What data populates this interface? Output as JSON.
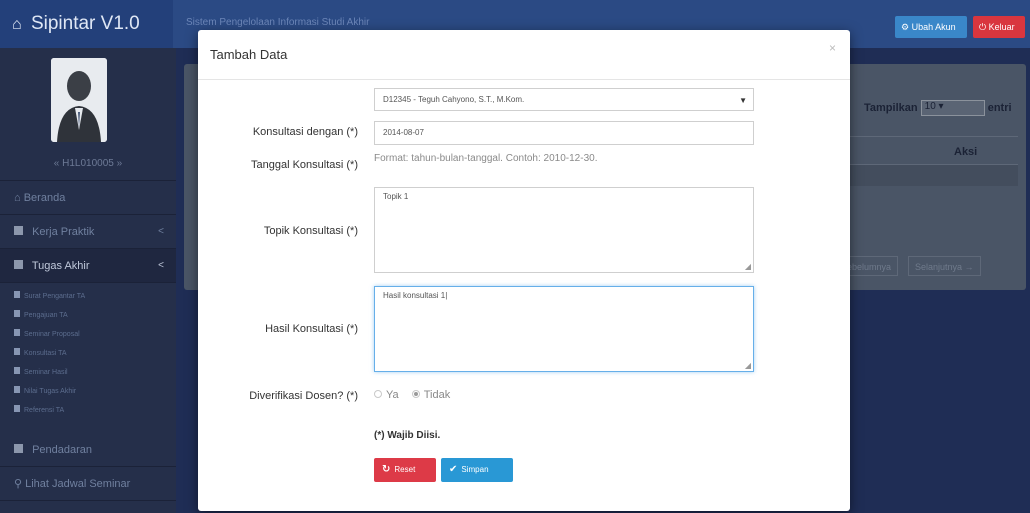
{
  "app": {
    "brand": "Sipintar V1.0",
    "subtitle": "Sistem Pengelolaan Informasi Studi Akhir",
    "btn_akun": "Ubah Akun",
    "btn_keluar": "Keluar"
  },
  "sidebar": {
    "username": "« H1L010005 »",
    "items": [
      {
        "label": "Beranda"
      },
      {
        "label": "Kerja Praktik"
      },
      {
        "label": "Tugas Akhir"
      }
    ],
    "sub_items": [
      {
        "label": "Surat Pengantar TA"
      },
      {
        "label": "Pengajuan TA"
      },
      {
        "label": "Seminar Proposal"
      },
      {
        "label": "Konsultasi TA"
      },
      {
        "label": "Seminar Hasil"
      },
      {
        "label": "Nilai Tugas Akhir"
      },
      {
        "label": "Referensi TA"
      }
    ],
    "bottom_items": [
      {
        "label": "Pendadaran"
      },
      {
        "label": "Lihat Jadwal Seminar"
      }
    ]
  },
  "background_panel": {
    "tampilkan": "Tampilkan",
    "tampilkan_value": "10",
    "entri": "entri",
    "aksi": "Aksi",
    "sebelumnya": "ebelumnya",
    "selanjutnya": "Selanjutnya →"
  },
  "modal": {
    "title": "Tambah Data",
    "close": "×",
    "fields": {
      "konsultasi_label": "Konsultasi dengan (*)",
      "konsultasi_value": "D12345 - Teguh Cahyono, S.T., M.Kom.",
      "tanggal_label": "Tanggal Konsultasi (*)",
      "tanggal_value": "2014-08-07",
      "tanggal_hint": "Format: tahun-bulan-tanggal. Contoh: 2010-12-30.",
      "topik_label": "Topik Konsultasi (*)",
      "topik_value": "Topik 1",
      "hasil_label": "Hasil Konsultasi (*)",
      "hasil_value": "Hasil konsultasi 1|",
      "verifikasi_label": "Diverifikasi Dosen? (*)",
      "verifikasi_options": [
        "Ya",
        "Tidak"
      ],
      "verifikasi_selected": "Tidak"
    },
    "required_note": "(*) Wajib Diisi.",
    "btn_reset": "Reset",
    "btn_simpan": "Simpan"
  }
}
